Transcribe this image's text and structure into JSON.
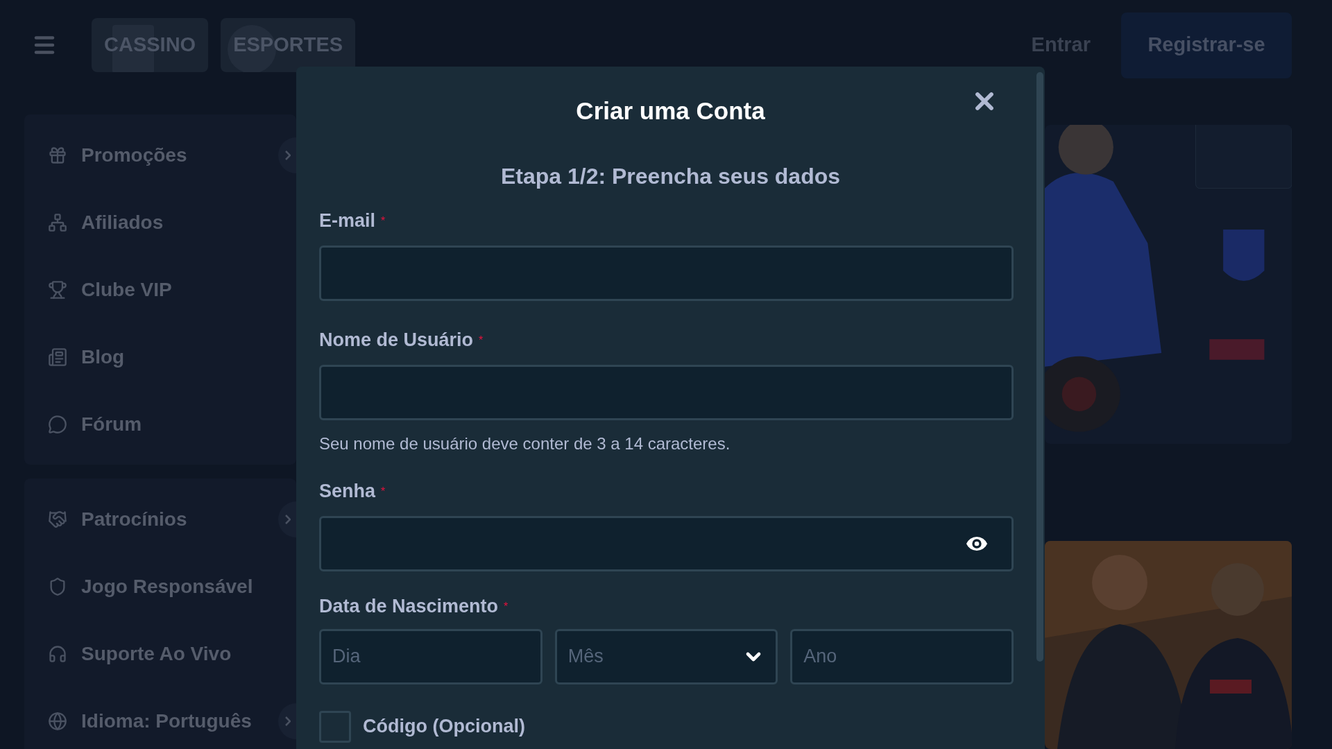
{
  "header": {
    "tabs": [
      {
        "label": "CASSINO",
        "kind": "casino"
      },
      {
        "label": "ESPORTES",
        "kind": "sports"
      }
    ],
    "login": "Entrar",
    "register": "Registrar-se"
  },
  "sidebar": {
    "groups": [
      {
        "items": [
          {
            "label": "Promoções",
            "expandable": true
          },
          {
            "label": "Afiliados",
            "expandable": false
          },
          {
            "label": "Clube VIP",
            "expandable": false
          },
          {
            "label": "Blog",
            "expandable": false
          },
          {
            "label": "Fórum",
            "expandable": false
          }
        ]
      },
      {
        "items": [
          {
            "label": "Patrocínios",
            "expandable": true
          },
          {
            "label": "Jogo Responsável",
            "expandable": false
          },
          {
            "label": "Suporte Ao Vivo",
            "expandable": false
          },
          {
            "label": "Idioma: Português",
            "expandable": true
          }
        ]
      }
    ]
  },
  "modal": {
    "title": "Criar uma Conta",
    "required_mark": "*",
    "step": "Etapa 1/2: Preencha seus dados",
    "fields": [
      {
        "label": "E-mail",
        "required": true,
        "kind": "text"
      },
      {
        "label": "Nome de Usuário",
        "required": true,
        "kind": "text",
        "hint": "Seu nome de usuário deve conter de 3 a 14 caracteres."
      },
      {
        "label": "Senha",
        "required": true,
        "kind": "password"
      }
    ],
    "birthdate": {
      "label": "Data de Nascimento",
      "required": true,
      "parts": [
        {
          "placeholder": "Dia",
          "kind": "input"
        },
        {
          "placeholder": "Mês",
          "kind": "select"
        },
        {
          "placeholder": "Ano",
          "kind": "input"
        }
      ]
    },
    "code": {
      "label": "Código (Opcional)",
      "checked": false
    }
  }
}
